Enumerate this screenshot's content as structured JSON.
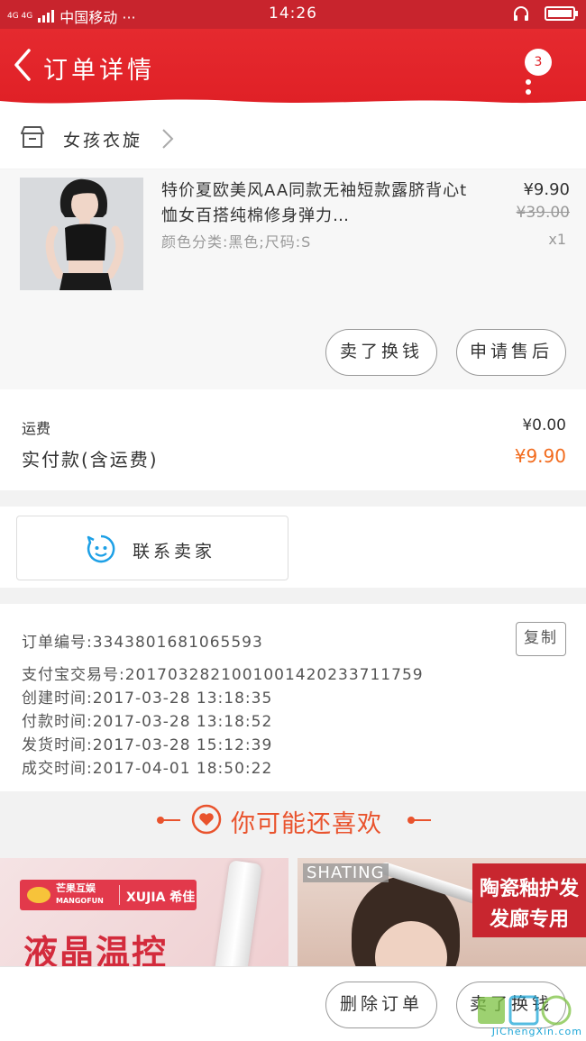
{
  "status_bar": {
    "network": "4G 4G",
    "carrier": "中国移动 ···",
    "time": "14:26"
  },
  "header": {
    "title": "订单详情",
    "badge_count": "3"
  },
  "shop": {
    "name": "女孩衣旋"
  },
  "product": {
    "title": "特价夏欧美风AA同款无袖短款露脐背心t恤女百搭纯棉修身弹力…",
    "sku": "颜色分类:黑色;尺码:S",
    "price": "¥9.90",
    "original_price": "¥39.00",
    "quantity": "x1",
    "buttons": {
      "refund": "卖了换钱",
      "after_sale": "申请售后"
    }
  },
  "payment": {
    "shipping_label": "运费",
    "shipping_value": "¥0.00",
    "total_label": "实付款(含运费)",
    "total_value": "¥9.90"
  },
  "contact": {
    "label": "联系卖家"
  },
  "order_info": {
    "order_no": "订单编号:3343801681065593",
    "copy_label": "复制",
    "alipay_no": "支付宝交易号:2017032821001001420233711759",
    "created": "创建时间:2017-03-28 13:18:35",
    "paid": "付款时间:2017-03-28 13:18:52",
    "shipped": "发货时间:2017-03-28 15:12:39",
    "completed": "成交时间:2017-04-01 18:50:22"
  },
  "recommend": {
    "title": "你可能还喜欢",
    "tile1": {
      "brand1": "芒果互娱",
      "brand1_sub": "MANGOFUN",
      "brand2": "XUJIA 希佳",
      "headline": "液晶温控"
    },
    "tile2": {
      "brand": "SHATING",
      "tag_line1": "陶瓷釉护发",
      "tag_line2": "发廊专用"
    }
  },
  "bottom_bar": {
    "delete_order": "删除订单",
    "sell_again": "卖了换钱"
  },
  "watermark": {
    "text": "JiChengXin.com"
  },
  "colors": {
    "header_red": "#e02026",
    "price_orange": "#f26b1d",
    "accent_orange": "#e9532d"
  }
}
